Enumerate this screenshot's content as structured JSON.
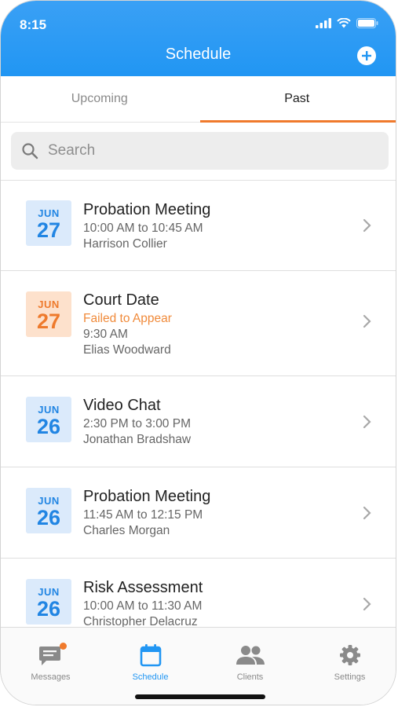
{
  "status_bar": {
    "time": "8:15"
  },
  "header": {
    "title": "Schedule"
  },
  "tabs": [
    {
      "label": "Upcoming"
    },
    {
      "label": "Past"
    }
  ],
  "search": {
    "placeholder": "Search"
  },
  "appointments": [
    {
      "month": "JUN",
      "day": "27",
      "title": "Probation Meeting",
      "time": "10:00 AM to 10:45 AM",
      "person": "Harrison Collier",
      "badge_color": "blue"
    },
    {
      "month": "JUN",
      "day": "27",
      "title": "Court Date",
      "status": "Failed to Appear",
      "time": "9:30 AM",
      "person": "Elias Woodward",
      "badge_color": "orange"
    },
    {
      "month": "JUN",
      "day": "26",
      "title": "Video Chat",
      "time": "2:30 PM to 3:00 PM",
      "person": "Jonathan Bradshaw",
      "badge_color": "blue"
    },
    {
      "month": "JUN",
      "day": "26",
      "title": "Probation Meeting",
      "time": "11:45 AM to 12:15 PM",
      "person": "Charles Morgan",
      "badge_color": "blue"
    },
    {
      "month": "JUN",
      "day": "26",
      "title": "Risk Assessment",
      "time": "10:00 AM to 11:30 AM",
      "person": "Christopher Delacruz",
      "badge_color": "blue"
    }
  ],
  "tabbar": [
    {
      "label": "Messages",
      "icon": "messages-icon",
      "badge": true
    },
    {
      "label": "Schedule",
      "icon": "calendar-icon",
      "active": true
    },
    {
      "label": "Clients",
      "icon": "clients-icon"
    },
    {
      "label": "Settings",
      "icon": "gear-icon"
    }
  ],
  "colors": {
    "header_blue": "#2196f3",
    "accent_orange": "#f07a2c",
    "badge_blue_bg": "#dbeafb",
    "badge_orange_bg": "#fde1cc"
  }
}
